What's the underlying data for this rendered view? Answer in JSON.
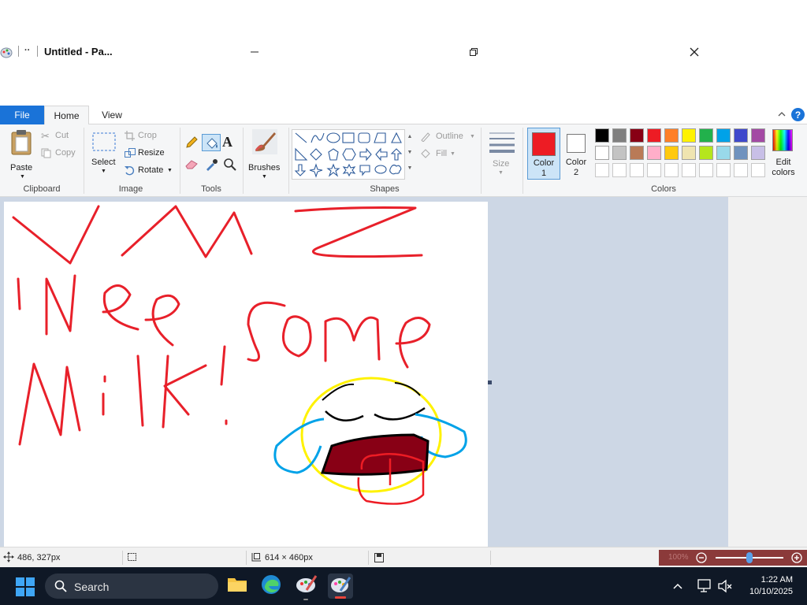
{
  "window": {
    "title": "Untitled - Pa...",
    "more_label": "··"
  },
  "tabs": [
    "File",
    "Home",
    "View"
  ],
  "help_label": "?",
  "ribbon": {
    "clipboard": {
      "paste": "Paste",
      "cut": "Cut",
      "copy": "Copy",
      "label": "Clipboard"
    },
    "image": {
      "select": "Select",
      "crop": "Crop",
      "resize": "Resize",
      "rotate": "Rotate",
      "label": "Image"
    },
    "tools": {
      "label": "Tools"
    },
    "brushes": {
      "label": "Brushes"
    },
    "shapes": {
      "outline": "Outline",
      "fill": "Fill",
      "label": "Shapes"
    },
    "size": {
      "label": "Size"
    },
    "colors": {
      "color1_label": "Color 1",
      "color2_label": "Color 2",
      "color1": "#ed1c24",
      "color2": "#ffffff",
      "edit_label": "Edit colors",
      "label": "Colors",
      "palette_row1": [
        "#000000",
        "#7f7f7f",
        "#880015",
        "#ed1c24",
        "#ff7f27",
        "#fff200",
        "#22b14c",
        "#00a2e8",
        "#3f48cc",
        "#a349a4"
      ],
      "palette_row2": [
        "#ffffff",
        "#c3c3c3",
        "#b97a57",
        "#ffaec9",
        "#ffc90e",
        "#efe4b0",
        "#b5e61d",
        "#99d9ea",
        "#7092be",
        "#c8bfe7"
      ]
    }
  },
  "status": {
    "cursor_pos": "486, 327px",
    "canvas_size": "614 × 460px",
    "zoom": "100%"
  },
  "drawing": {
    "ink_color": "#e8202a",
    "text_lines": [
      "I Nee Some",
      "Milk!"
    ]
  },
  "taskbar": {
    "search_placeholder": "Search",
    "time": "1:22 AM",
    "date": "10/10/2025"
  }
}
